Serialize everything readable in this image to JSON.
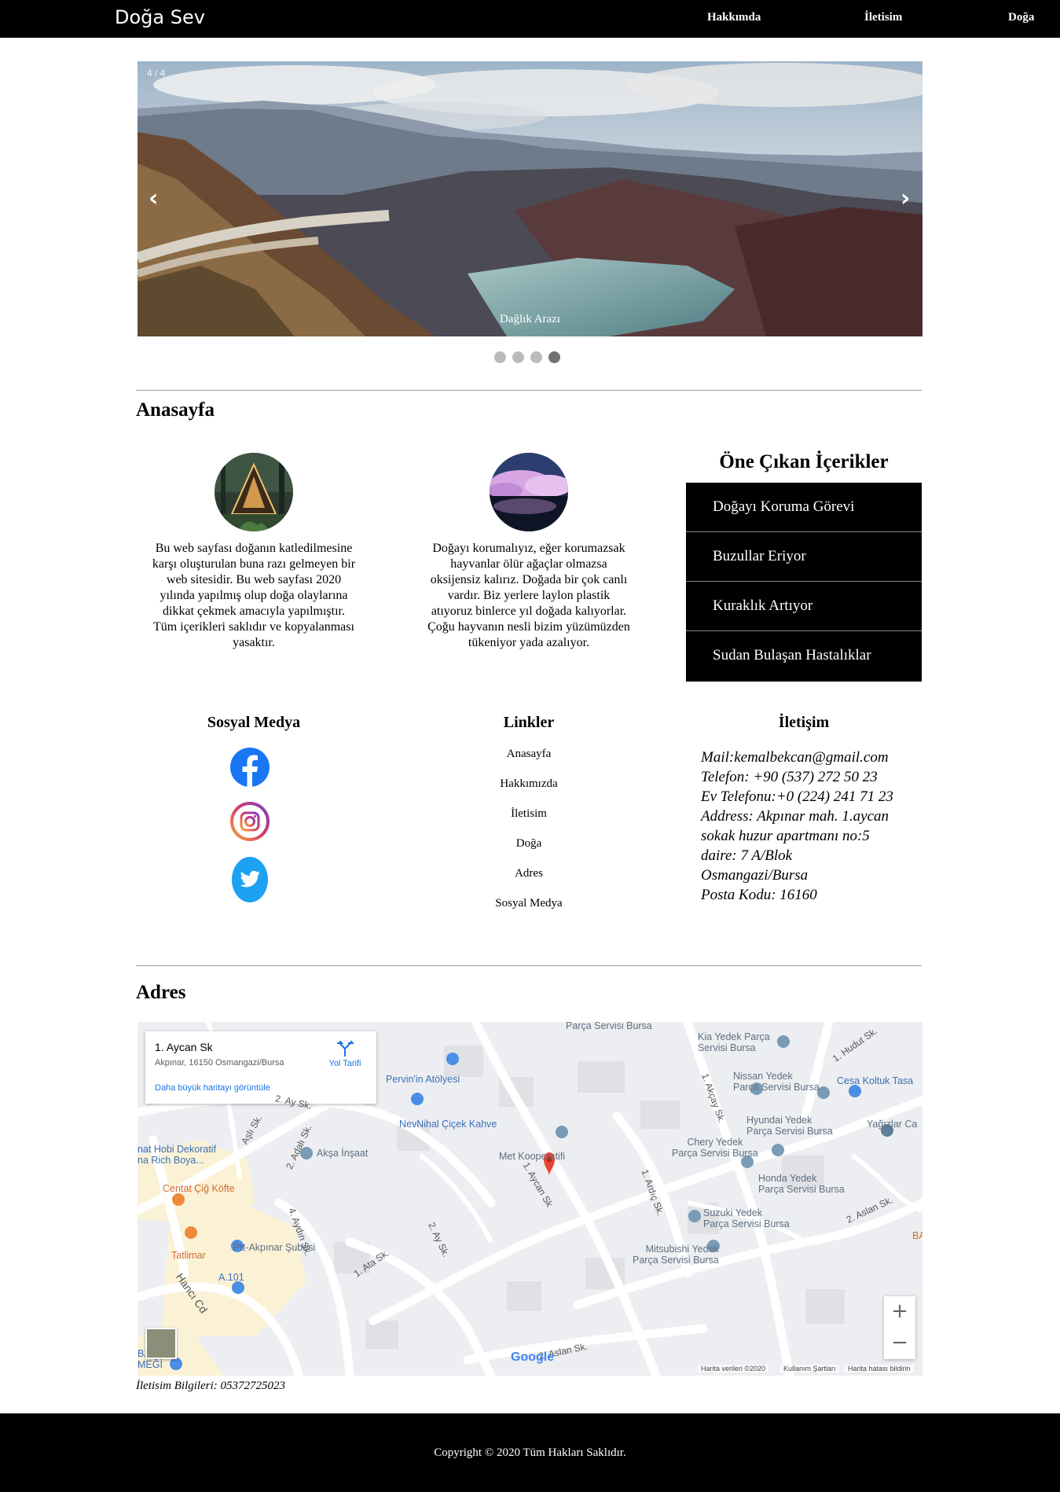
{
  "nav": {
    "brand": "Doğa Sev",
    "links": [
      "Hakkımda",
      "İletisim",
      "Doğa"
    ]
  },
  "slideshow": {
    "counter": "4 / 4",
    "prev_arrow": "‹",
    "next_arrow": "›",
    "caption": "Dağlık Arazı",
    "slide_count": 4,
    "active_slide": 4
  },
  "home": {
    "title": "Anasayfa",
    "col1_text": "Bu web sayfası doğanın katledilmesine karşı oluşturulan buna razı gelmeyen bir web sitesidir. Bu web sayfası 2020 yılında yapılmış olup doğa olaylarına dikkat çekmek amacıyla yapılmıştır. Tüm içerikleri saklıdır ve kopyalanması yasaktır.",
    "col2_text": "Doğayı korumalıyız, eğer korumazsak hayvanlar ölür ağaçlar olmazsa oksijensiz kalırız. Doğada bir çok canlı vardır. Biz yerlere laylon plastik atıyoruz binlerce yıl doğada kalıyorlar. Çoğu hayvanın nesli bizim yüzümüzden tükeniyor yada azalıyor."
  },
  "featured": {
    "title": "Öne Çıkan İçerikler",
    "items": [
      "Doğayı Koruma Görevi",
      "Buzullar Eriyor",
      "Kuraklık Artıyor",
      "Sudan Bulaşan Hastalıklar"
    ]
  },
  "social": {
    "title": "Sosyal Medya",
    "icons": [
      "facebook-icon",
      "instagram-icon",
      "twitter-icon"
    ],
    "colors": {
      "facebook": "#1877f2",
      "twitter": "#1da1f2"
    }
  },
  "links": {
    "title": "Linkler",
    "items": [
      "Anasayfa",
      "Hakkımızda",
      "İletisim",
      "Doğa",
      "Adres",
      "Sosyal Medya"
    ]
  },
  "contact": {
    "title": "İletişim",
    "lines": [
      "Mail:kemalbekcan@gmail.com",
      "Telefon: +90 (537) 272 50 23",
      "Ev Telefonu:+0 (224) 241 71 23",
      "Address: Akpınar mah. 1.aycan",
      "sokak huzur apartmanı no:5",
      "daire: 7 A/Blok",
      "Osmangazi/Bursa",
      "Posta Kodu: 16160"
    ]
  },
  "address": {
    "title": "Adres",
    "map": {
      "place_name": "1. Aycan Sk",
      "place_address": "Akpınar, 16150 Osmangazi/Bursa",
      "directions_label": "Yol Tarifi",
      "bigger_map_label": "Daha büyük haritayı görüntüle",
      "zoom_in": "+",
      "zoom_out": "−",
      "google": "Google",
      "attrib_data": "Harita verileri ©2020",
      "attrib_terms": "Kullanım Şartları",
      "attrib_report": "Harita hatası bildirin",
      "labels": {
        "parca_servisi": "Parça Servisi Bursa",
        "kia": "Kia Yedek Parça\nServisi Bursa",
        "hudut": "1. Hudut Sk.",
        "pervin": "Pervin'in Atölyesi",
        "nissan": "Nissan Yedek\nParça Servisi Bursa",
        "cesa": "Cesa Koltuk Tasa",
        "akcay": "1. Akçay Sk.",
        "ay_sk_top": "2. Ay Sk.",
        "nevnihal": "NevNihal Çiçek Kahve",
        "hyundai": "Hyundai Yedek\nParça Servisi Bursa",
        "yagizlar": "Yağızlar Ca",
        "asli": "Aşlı Sk.",
        "adali": "2. Adalı Sk.",
        "aksa": "Akşa İnşaat",
        "met": "Met Kooperatifi",
        "chery": "Chery Yedek\nParça Servisi Bursa",
        "hobi": "nat Hobi Dekoratif\nna Rich Boya...",
        "aycan": "1. Aycan Sk",
        "honda": "Honda Yedek\nParça Servisi Bursa",
        "centat": "Centat Çiğ Köfte",
        "ardic": "1. Ardıç Sk.",
        "aydin": "4. Aydın Sk.",
        "aslan": "2. Aslan Sk.",
        "suzuki": "Suzuki Yedek\nParça Servisi Bursa",
        "ay_sk": "2. Ay Sk.",
        "tatlimar": "Tatlimar",
        "ptt": "Ptt-Akpınar Şubesi",
        "mitsubishi": "Mitsubishi Yedek\nParça Servisi Bursa",
        "ata": "1. Ata Sk.",
        "a101": "A.101",
        "hanci": "Hancı Cd",
        "bzon": "BZON\nMEĞİ",
        "aslan_bottom": "2. Aslan Sk.",
        "ba": "BA"
      }
    },
    "contact_info": "İletisim Bilgileri: 05372725023"
  },
  "footer": {
    "copyright": "Copyright © 2020 Tüm Hakları Saklıdır."
  }
}
